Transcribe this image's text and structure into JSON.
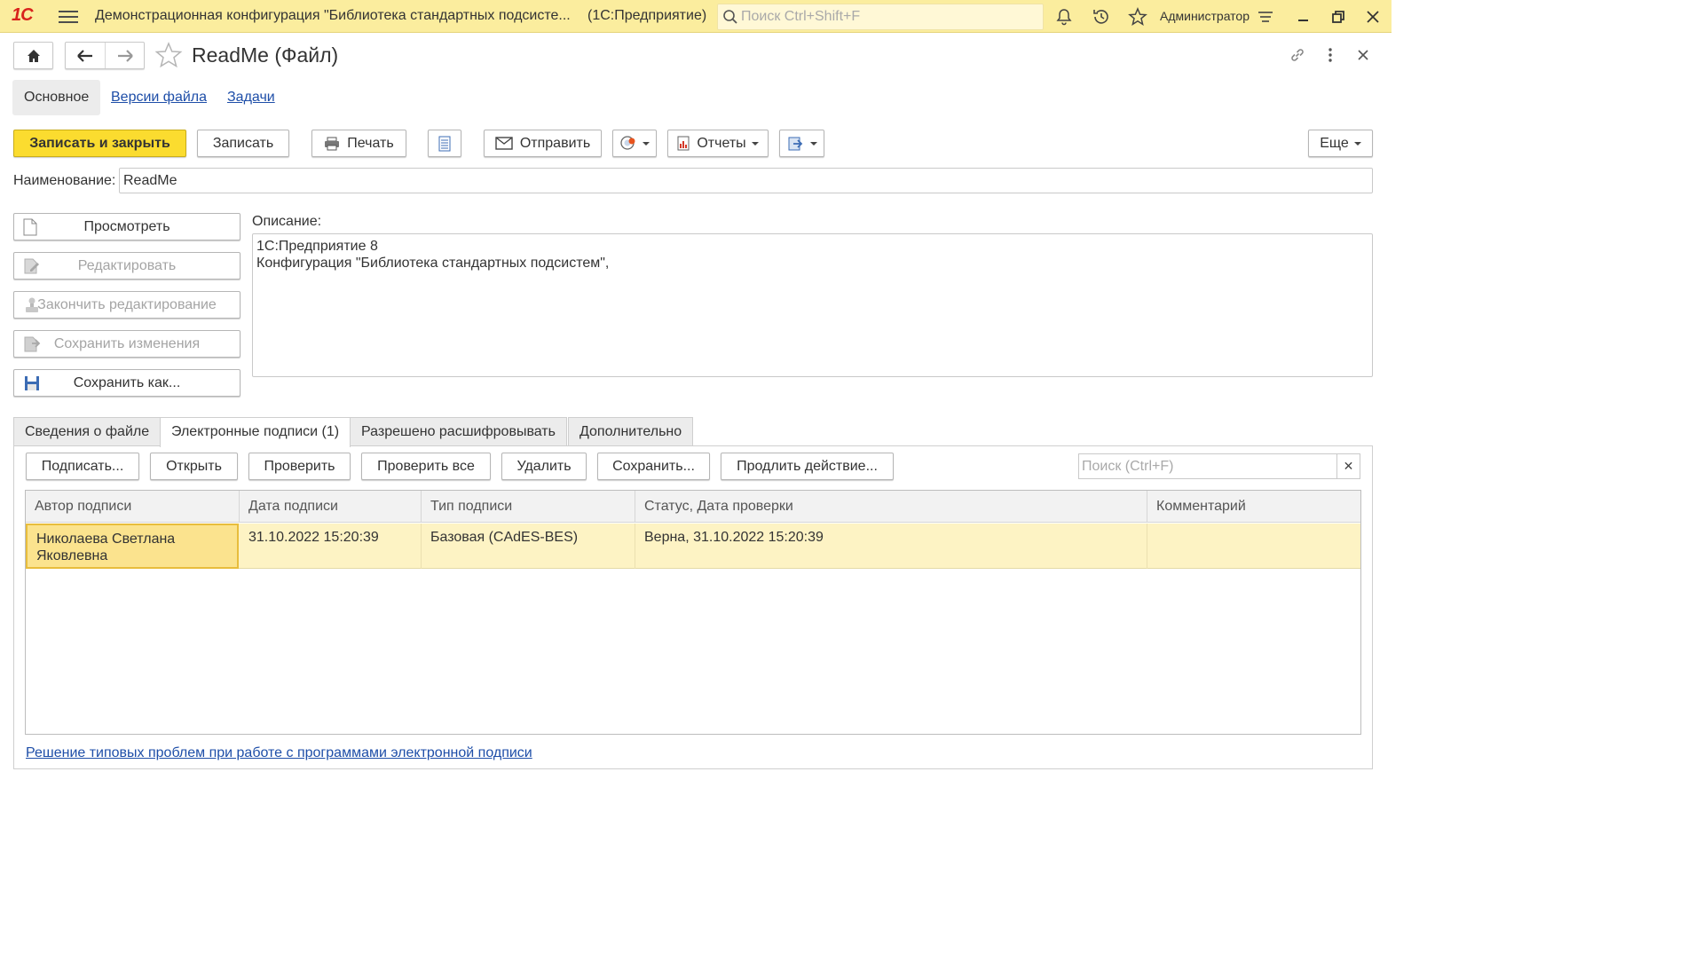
{
  "titlebar": {
    "logo": "1С",
    "app_title": "Демонстрационная конфигурация \"Библиотека стандартных подсисте...",
    "platform": "(1С:Предприятие)",
    "search_placeholder": "Поиск Ctrl+Shift+F",
    "user": "Администратор"
  },
  "form": {
    "title": "ReadMe (Файл)",
    "tabs": [
      {
        "label": "Основное",
        "active": true
      },
      {
        "label": "Версии файла",
        "active": false
      },
      {
        "label": "Задачи",
        "active": false
      }
    ]
  },
  "toolbar": {
    "save_close": "Записать и закрыть",
    "save": "Записать",
    "print": "Печать",
    "send": "Отправить",
    "reports": "Отчеты",
    "more": "Еще"
  },
  "fields": {
    "name_label": "Наименование:",
    "name_value": "ReadMe",
    "description_label": "Описание:",
    "description_value": "1С:Предприятие 8\nКонфигурация \"Библиотека стандартных подсистем\","
  },
  "side_buttons": {
    "view": "Просмотреть",
    "edit": "Редактировать",
    "finish_edit": "Закончить редактирование",
    "save_changes": "Сохранить изменения",
    "save_as": "Сохранить как..."
  },
  "lower_tabs": [
    {
      "label": "Сведения о файле",
      "active": false
    },
    {
      "label": "Электронные подписи (1)",
      "active": true
    },
    {
      "label": "Разрешено расшифровывать",
      "active": false
    },
    {
      "label": "Дополнительно",
      "active": false
    }
  ],
  "signatures": {
    "buttons": {
      "sign": "Подписать...",
      "open": "Открыть",
      "check": "Проверить",
      "check_all": "Проверить все",
      "delete": "Удалить",
      "save": "Сохранить...",
      "extend": "Продлить действие..."
    },
    "search_placeholder": "Поиск (Ctrl+F)",
    "columns": [
      "Автор подписи",
      "Дата подписи",
      "Тип подписи",
      "Статус, Дата проверки",
      "Комментарий"
    ],
    "rows": [
      {
        "author": "Николаева Светлана Яковлевна",
        "date": "31.10.2022 15:20:39",
        "type": "Базовая (CAdES-BES)",
        "status": "Верна, 31.10.2022 15:20:39",
        "comment": ""
      }
    ],
    "help_link": "Решение типовых проблем при работе с программами электронной подписи"
  },
  "colors": {
    "titlebar_bg": "#fbed9e",
    "primary_button": "#fbdc2f",
    "link": "#1e4ea8",
    "row_selected": "#fdf3c4",
    "logo": "#d8231c"
  }
}
